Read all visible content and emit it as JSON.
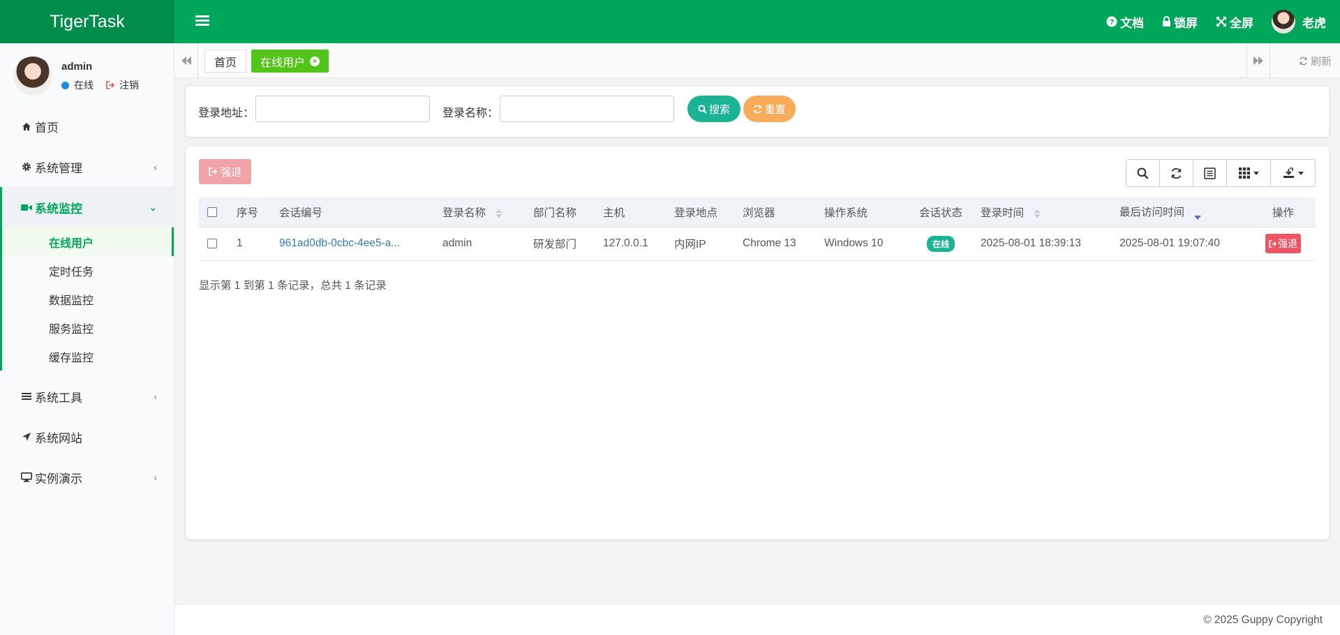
{
  "brand": "TigerTask",
  "header": {
    "docs": "文档",
    "lock": "锁屏",
    "fullscreen": "全屏",
    "user": "老虎"
  },
  "sidebar": {
    "user": {
      "name": "admin",
      "status": "在线",
      "logout": "注销"
    },
    "menu": [
      {
        "label": "首页",
        "icon": "home-icon"
      },
      {
        "label": "系统管理",
        "icon": "gear-icon"
      },
      {
        "label": "系统监控",
        "icon": "video-icon"
      },
      {
        "label": "系统工具",
        "icon": "bars-icon"
      },
      {
        "label": "系统网站",
        "icon": "location-arrow-icon"
      },
      {
        "label": "实例演示",
        "icon": "desktop-icon"
      }
    ],
    "submenu": [
      "在线用户",
      "定时任务",
      "数据监控",
      "服务监控",
      "缓存监控"
    ]
  },
  "tabs": {
    "home": "首页",
    "active": "在线用户",
    "refresh": "刷新"
  },
  "search": {
    "ipaddr_label": "登录地址：",
    "ipaddr_value": "",
    "login_name_label": "登录名称：",
    "login_name_value": "",
    "search_btn": "搜索",
    "reset_btn": "重置"
  },
  "table": {
    "kick_btn": "强退",
    "columns": [
      "序号",
      "会话编号",
      "登录名称",
      "部门名称",
      "主机",
      "登录地点",
      "浏览器",
      "操作系统",
      "会话状态",
      "登录时间",
      "最后访问时间",
      "操作"
    ],
    "rows": [
      {
        "index": "1",
        "session_id": "961ad0db-0cbc-4ee5-a...",
        "login_name": "admin",
        "dept": "研发部门",
        "host": "127.0.0.1",
        "location": "内网IP",
        "browser": "Chrome 13",
        "os": "Windows 10",
        "status": "在线",
        "login_time": "2025-08-01 18:39:13",
        "last_access": "2025-08-01 19:07:40",
        "action": "强退"
      }
    ],
    "pagination": "显示第 1 到第 1 条记录，总共 1 条记录"
  },
  "footer": "© 2025 Guppy Copyright",
  "colors": {
    "primary": "#00a65a",
    "active_tab": "#52c41a",
    "search_btn": "#1ab394",
    "reset_btn": "#f8ac59",
    "danger": "#ed5565"
  }
}
